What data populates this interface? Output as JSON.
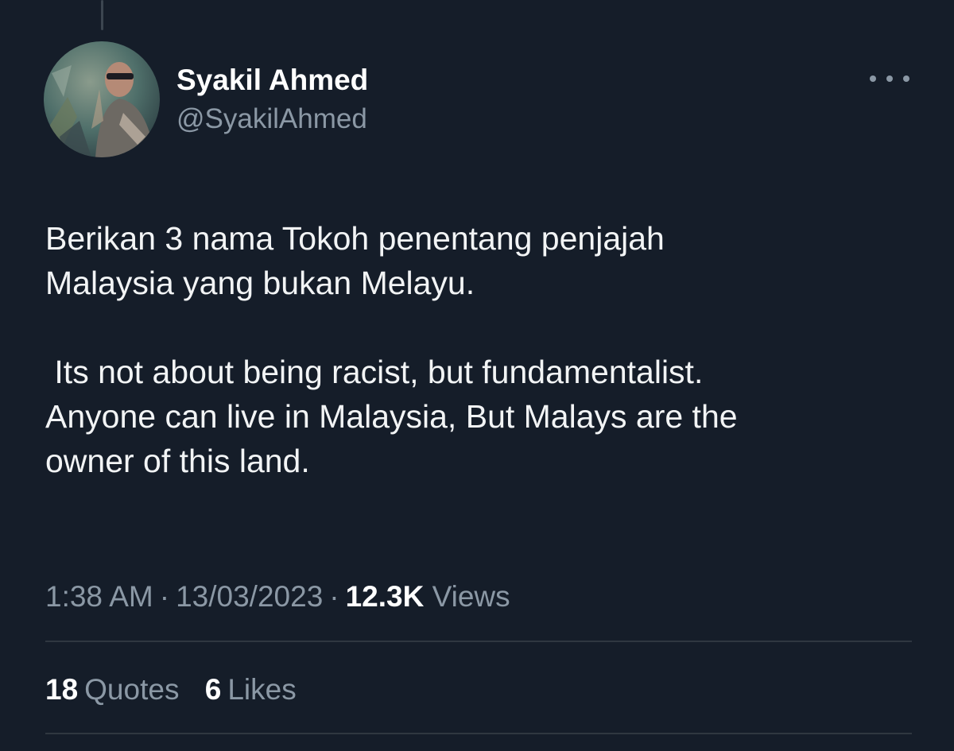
{
  "tweet": {
    "author": {
      "display_name": "Syakil Ahmed",
      "handle": "@SyakilAhmed"
    },
    "text": {
      "paragraph_1_line_1": "Berikan 3 nama Tokoh penentang penjajah",
      "paragraph_1_line_2": "Malaysia yang bukan Melayu.",
      "paragraph_2_line_1": " Its not about being racist, but fundamentalist.",
      "paragraph_2_line_2": "Anyone can live in Malaysia, But Malays are the",
      "paragraph_2_line_3": "owner of this land."
    },
    "meta": {
      "time": "1:38 AM",
      "date": "13/03/2023",
      "separator": "·",
      "views_count": "12.3K",
      "views_label": "Views"
    },
    "stats": {
      "quotes_count": "18",
      "quotes_label": "Quotes",
      "likes_count": "6",
      "likes_label": "Likes"
    }
  },
  "icons": {
    "more": "more-horizontal-icon"
  },
  "colors": {
    "background": "#151d29",
    "primary_text": "#ffffff",
    "secondary_text": "#8b98a5",
    "divider": "#2f3740"
  }
}
